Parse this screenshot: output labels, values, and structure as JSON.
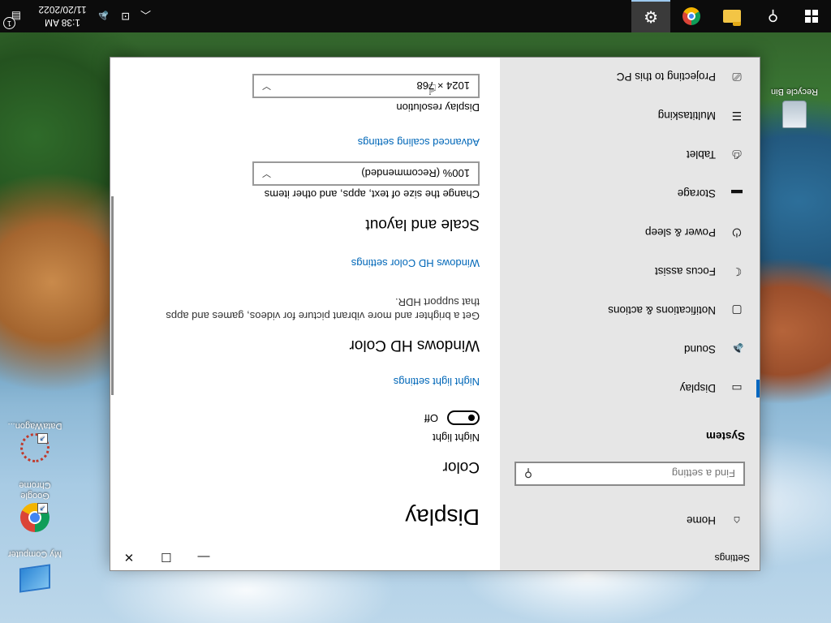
{
  "window": {
    "title": "Settings",
    "controls": {
      "minimize": "—",
      "maximize": "☐",
      "close": "✕"
    }
  },
  "sidebar": {
    "home": {
      "label": "Home",
      "icon": "home-icon",
      "glyph": "⌂"
    },
    "search": {
      "placeholder": "Find a setting",
      "icon": "search-icon",
      "glyph": "⚲"
    },
    "section": "System",
    "items": [
      {
        "label": "Display",
        "icon": "monitor-icon",
        "glyph": "▭",
        "active": true
      },
      {
        "label": "Sound",
        "icon": "speaker-icon",
        "glyph": "🔈"
      },
      {
        "label": "Notifications & actions",
        "icon": "notification-icon",
        "glyph": "▢"
      },
      {
        "label": "Focus assist",
        "icon": "moon-icon",
        "glyph": "☾"
      },
      {
        "label": "Power & sleep",
        "icon": "power-icon",
        "glyph": "⏻"
      },
      {
        "label": "Storage",
        "icon": "storage-icon",
        "glyph": "▬"
      },
      {
        "label": "Tablet",
        "icon": "tablet-icon",
        "glyph": "⎙"
      },
      {
        "label": "Multitasking",
        "icon": "multitasking-icon",
        "glyph": "☰"
      },
      {
        "label": "Projecting to this PC",
        "icon": "projector-icon",
        "glyph": "⎚"
      }
    ]
  },
  "content": {
    "title": "Display",
    "color_heading": "Color",
    "night_light_label": "Night light",
    "night_light_state": "Off",
    "night_light_link": "Night light settings",
    "hd_color_heading": "Windows HD Color",
    "hd_color_desc_1": "Get a brighter and more vibrant picture for videos, games and apps",
    "hd_color_desc_2": "that support HDR.",
    "hd_color_link": "Windows HD Color settings",
    "scale_heading": "Scale and layout",
    "scale_desc": "Change the size of text, apps, and other items",
    "scale_value": "100% (Recommended)",
    "scale_link": "Advanced scaling settings",
    "resolution_label": "Display resolution",
    "resolution_value": "1024 × 768"
  },
  "desktop": {
    "icons": [
      {
        "label": "My Computer",
        "icon": "computer-icon"
      },
      {
        "label": "Google Chrome",
        "icon": "chrome-icon"
      },
      {
        "label": "DataWagon...",
        "icon": "datawagon-icon"
      },
      {
        "label": "Recycle Bin",
        "icon": "recycle-bin-icon"
      }
    ]
  },
  "taskbar": {
    "pinned": [
      {
        "name": "Start",
        "icon": "windows-start-icon"
      },
      {
        "name": "Search",
        "icon": "search-icon"
      },
      {
        "name": "File Explorer",
        "icon": "folder-icon"
      },
      {
        "name": "Google Chrome",
        "icon": "chrome-icon"
      },
      {
        "name": "Settings",
        "icon": "gear-icon",
        "active": true
      }
    ],
    "tray": {
      "chevron": "︿",
      "network": "⊡",
      "volume": "🔈",
      "time": "1:38 AM",
      "date": "11/20/2022",
      "notification_count": "1",
      "notification_glyph": "▤"
    }
  },
  "colors": {
    "accent": "#0067c0",
    "link": "#0067b8",
    "sidebar_bg": "#e6e6e6",
    "taskbar_bg": "#0c0c0c"
  }
}
